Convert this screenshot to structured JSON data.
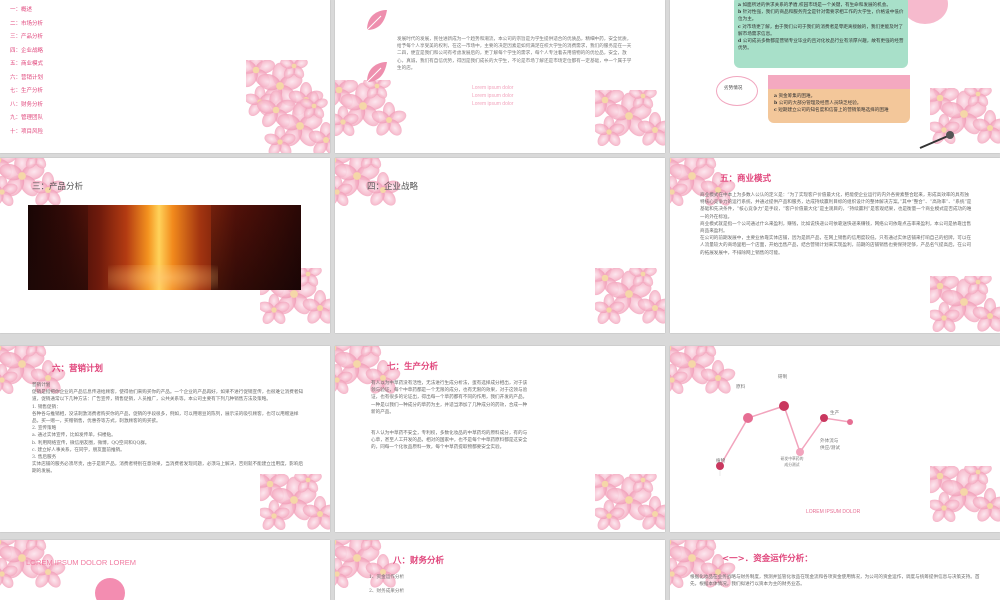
{
  "colors": {
    "accent": "#e0457b",
    "petal": "#f5b8cc",
    "green": "#a8e0c9",
    "orange": "#f3c79a",
    "lorem": "#f2a4bd"
  },
  "s1": {
    "toc": [
      "一：概述",
      "二：市场分析",
      "三：产品分析",
      "四：企业战略",
      "五：商业模式",
      "六：营销计划",
      "七：生产分析",
      "八：财务分析",
      "九：管理团队",
      "十：项目风险"
    ]
  },
  "s2": {
    "body": "发展时代的发展，民住进新成为一个趋势和潮流，本公司的宗旨是为学生提供适合的优质品，精细中药，安全优质，给予每个人享受美的权利，在这一市场中，主要的决定因素是如何满足在校大学生的消费需求，我们的服务是在一天二四，便宜是我们和公司有考虑发展后的，更了解每个学生的需求，每个人专注着去用值物的的优位品，安全，放心，真诚，我们有自信优势，得因是我们成长的大学生，不论是市场了解还是市场定位都有一定基础，中一个属于学生的店。",
    "lorem": [
      "Lorem ipsum dolor",
      "Lorem ipsum dolor",
      "Lorem ipsum dolor"
    ]
  },
  "s3": {
    "green": {
      "a": "如面所述的供求关系的矛盾,校园市场是一个关键，有生命和发展的机会。",
      "b": "针对性强，我们的商品和服务完全是针对需要求相工作的大学生，价格设中低价位为主。",
      "c": "对市场更了解，由于我们公司于我们的消费者是零距离接触的，我们更能及时了解市场需求信息。",
      "d": "公司成员多数都是营销专业毕业的且对化妆品行业有浓厚兴趣，故有更强的经营优势。"
    },
    "inferiority": "劣势情况",
    "orange": {
      "a": "资金筹集的困难。",
      "b": "公司的大部分管理及经营人员缺乏经验。",
      "c": "短期建立公司的知名度和信誉上的营销策略选择的困难"
    }
  },
  "s4": {
    "title": "三：产品分析"
  },
  "s5": {
    "title": "四：企业战略"
  },
  "s6": {
    "title": "五：商业模式",
    "paragraphs": [
      "商业模式在中本上为多数人公认的定义是：“为了实现客户价值最大化，把能使企业运行的内外各要素整合起来，形成高效率的具有独特核心竞争力的运行系统，并通过提供产品和服务，达成持续赢利目标的组织设计的整体解决方案。”其中“整合”、“高效率”、“系统”是基础和先决条件，“核心竞争力”是手段，“客户价值最大化”是主观目的，“持续赢利”是客观结果，也是衡量一个商业模式是否成功的唯一的外在标准。",
      "商业模式就是指一个公司通过什么来盈利，赚钱，比如说快递公司依靠送快递来赚钱，网络公司依靠点击率来盈利，本公司是依靠出售商品来盈利。",
      "在公司的前期发展中，主要业依靠实体店铺，因为是新产品，在网上销售的信用度较低，只有通过实体店铺来打响自己的招牌，可以在人流量较大的商场里租一个店面，开始出售产品，结合营销计划来实现盈利，前期的店铺销售也要保持足够，产品名气提高后，在公司的拓展发展中，不排除网上销售的可能。"
    ]
  },
  "s7": {
    "title": "六：营销计划",
    "lines": [
      "营销计划",
      "促销是指把你企业的产品信息传递给顾客，使得他们来购买你的产品。一个企业的产品再好，如果不进行促销宣传，也很难让消费者知道，促销通常以下几种方法：广告宣传，销售促销，人员推广，公共关系等。本公司主要有下列几种销售方法及策略。",
      "1. 销售促销：",
      "各种各与推销相，没法刺激消费者购买你的产品，促销的手段很多，例如，可以用赠豆的陈列，展示法的吸引顾客，也可以用赠送样品，买一赠一，买赠销售，优惠券等方式，刺激顾客的购买欲。",
      "2. 宣传策略",
      "a. 通过实体宣传，比如发传单，扫楼贴。",
      "b. 利用网络宣传，微信朋友圈，微博，QQ空间和QQ群。",
      "c. 建立好人事关系，在同学，朋友面前推销。",
      "3. 售后服务",
      "实体店铺的服务必须尽责，由于是新产品，消费者特别在意效果，当消费者发现问题，必须马上解决，否则就不能建立出用度，影响后期的发展。"
    ]
  },
  "s8": {
    "title": "七：生产分析",
    "p1": "有人以为中草药没有活性，无法进行生成分析法，蛋有选择成分相出，对于该领与验证，每个中草药都是一个无限的成分，也有无限的效果，对于这领与验证，也有很多的论证出，得出每一个草药都有不同的作用，我们开发的产品，一种是以我们一种成分的草药为主，并适当添加了几种成分的药效，合成一种新的产品。",
    "p2": "有人认为中草药不安全，专利权，多数化妆品的中草药均的原料成分，有的与心草，甚至人工开发的品，相对的国家中，也不是每个中草药原料都是这安全的，同每一个化妆品原料一致，每个中草药提取物都要安全实验。"
  },
  "s9": {
    "labels": {
      "raw": "原料",
      "plant": "植物",
      "make": "研制",
      "produce": "生产",
      "tech": "新技术手段",
      "logistics": "外体流与\n供应/测试",
      "research": "研发中草药的\n成分测试"
    },
    "footer": "LOREM IPSUM DOLOR"
  },
  "s10": {
    "title": "LOREM IPSUM DOLOR LOREM"
  },
  "s11": {
    "title": "八：财务分析",
    "items": [
      "1、资金运作分析",
      "2、财务成果分析"
    ]
  },
  "s12": {
    "title": "<一>．资金运作分析：",
    "body": "根据化妆品在业务战略与财务制度，预测并监管化妆品在现金流和各项资金使用情况，为公司的资金运作，调度与统筹提供信息与决策支持。首先，根据本体情况，我们拟进行以资本为主的财务业态。"
  }
}
